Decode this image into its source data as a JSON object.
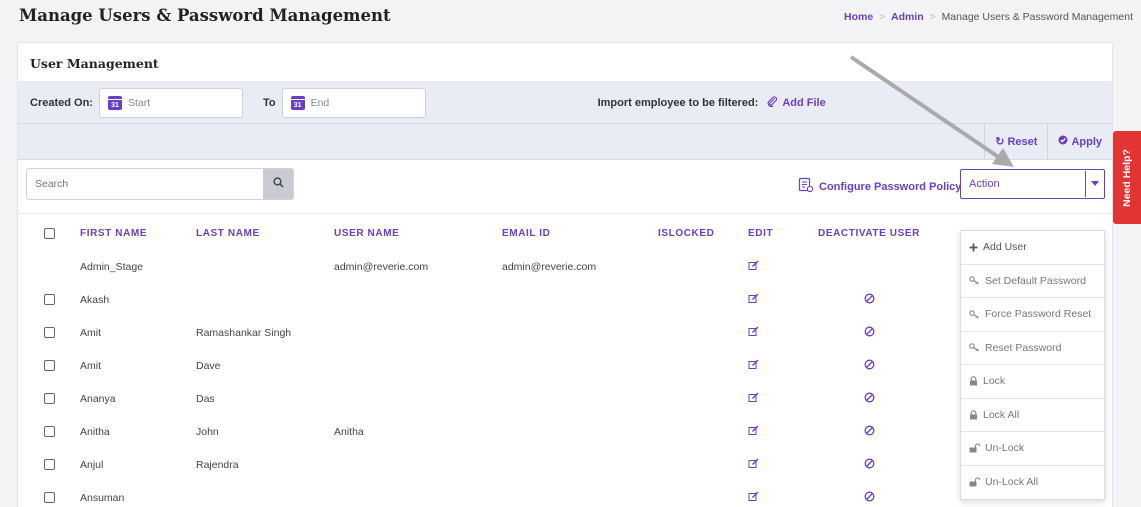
{
  "page": {
    "title": "Manage Users & Password Management",
    "breadcrumb": [
      "Home",
      "Admin",
      "Manage Users & Password Management"
    ]
  },
  "card": {
    "title": "User Management"
  },
  "filters": {
    "created_on_label": "Created On:",
    "start_placeholder": "Start",
    "to_label": "To",
    "end_placeholder": "End",
    "calendar_number": "31",
    "import_label": "Import employee to be filtered:",
    "add_file_label": "Add File",
    "reset_label": "Reset",
    "apply_label": "Apply"
  },
  "toolbar": {
    "search_placeholder": "Search",
    "configure_policy_label": "Configure Password Policy",
    "action_label": "Action"
  },
  "table": {
    "columns": [
      "FIRST NAME",
      "LAST NAME",
      "USER NAME",
      "EMAIL ID",
      "ISLOCKED",
      "EDIT",
      "DEACTIVATE USER"
    ],
    "rows": [
      {
        "first": "Admin_Stage",
        "last": "",
        "user": "admin@reverie.com",
        "email": "admin@reverie.com"
      },
      {
        "first": "Akash",
        "last": "",
        "user": "",
        "email": ""
      },
      {
        "first": "Amit",
        "last": "Ramashankar Singh",
        "user": "",
        "email": ""
      },
      {
        "first": "Amit",
        "last": "Dave",
        "user": "",
        "email": ""
      },
      {
        "first": "Ananya",
        "last": "Das",
        "user": "",
        "email": ""
      },
      {
        "first": "Anitha",
        "last": "John",
        "user": "Anitha",
        "email": ""
      },
      {
        "first": "Anjul",
        "last": "Rajendra",
        "user": "",
        "email": ""
      },
      {
        "first": "Ansuman",
        "last": "",
        "user": "",
        "email": ""
      }
    ]
  },
  "action_menu": [
    {
      "icon": "plus-icon",
      "label": "Add User"
    },
    {
      "icon": "key-icon",
      "label": "Set Default Password"
    },
    {
      "icon": "key-icon",
      "label": "Force Password Reset"
    },
    {
      "icon": "key-icon",
      "label": "Reset Password"
    },
    {
      "icon": "lock-icon",
      "label": "Lock"
    },
    {
      "icon": "lock-icon",
      "label": "Lock All"
    },
    {
      "icon": "unlock-icon",
      "label": "Un-Lock"
    },
    {
      "icon": "unlock-icon",
      "label": "Un-Lock All"
    }
  ],
  "help": {
    "label": "Need Help?"
  },
  "colors": {
    "accent": "#6a3fc8",
    "help": "#e33434"
  }
}
